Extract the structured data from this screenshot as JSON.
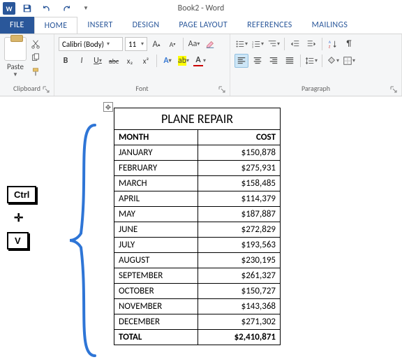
{
  "app": {
    "title": "Book2 - Word",
    "word_icon_text": "W"
  },
  "qat": {
    "save": "💾",
    "undo": "↶",
    "redo": "↷",
    "custom": "▾"
  },
  "tabs": {
    "file": "FILE",
    "home": "HOME",
    "insert": "INSERT",
    "design": "DESIGN",
    "page_layout": "PAGE LAYOUT",
    "references": "REFERENCES",
    "mailings": "MAILINGS"
  },
  "ribbon": {
    "clipboard": {
      "label": "Clipboard",
      "paste": "Paste"
    },
    "font": {
      "label": "Font",
      "name": "Calibri (Body)",
      "size": "11",
      "bold": "B",
      "italic": "I",
      "underline": "U",
      "strike": "abc",
      "sub": "x₂",
      "sup": "x²",
      "grow": "A",
      "shrink": "A",
      "case": "Aa",
      "clear": "🧽"
    },
    "paragraph": {
      "label": "Paragraph",
      "pilcrow": "¶"
    }
  },
  "overlay": {
    "ctrl": "Ctrl",
    "plus": "✛",
    "v": "V"
  },
  "table": {
    "title": "PLANE REPAIR",
    "headers": {
      "month": "MONTH",
      "cost": "COST"
    },
    "rows": [
      {
        "month": "JANUARY",
        "cost": "$150,878"
      },
      {
        "month": "FEBRUARY",
        "cost": "$275,931"
      },
      {
        "month": "MARCH",
        "cost": "$158,485"
      },
      {
        "month": "APRIL",
        "cost": "$114,379"
      },
      {
        "month": "MAY",
        "cost": "$187,887"
      },
      {
        "month": "JUNE",
        "cost": "$272,829"
      },
      {
        "month": "JULY",
        "cost": "$193,563"
      },
      {
        "month": "AUGUST",
        "cost": "$230,195"
      },
      {
        "month": "SEPTEMBER",
        "cost": "$261,327"
      },
      {
        "month": "OCTOBER",
        "cost": "$150,727"
      },
      {
        "month": "NOVEMBER",
        "cost": "$143,368"
      },
      {
        "month": "DECEMBER",
        "cost": "$271,302"
      }
    ],
    "total": {
      "label": "TOTAL",
      "value": "$2,410,871"
    }
  }
}
